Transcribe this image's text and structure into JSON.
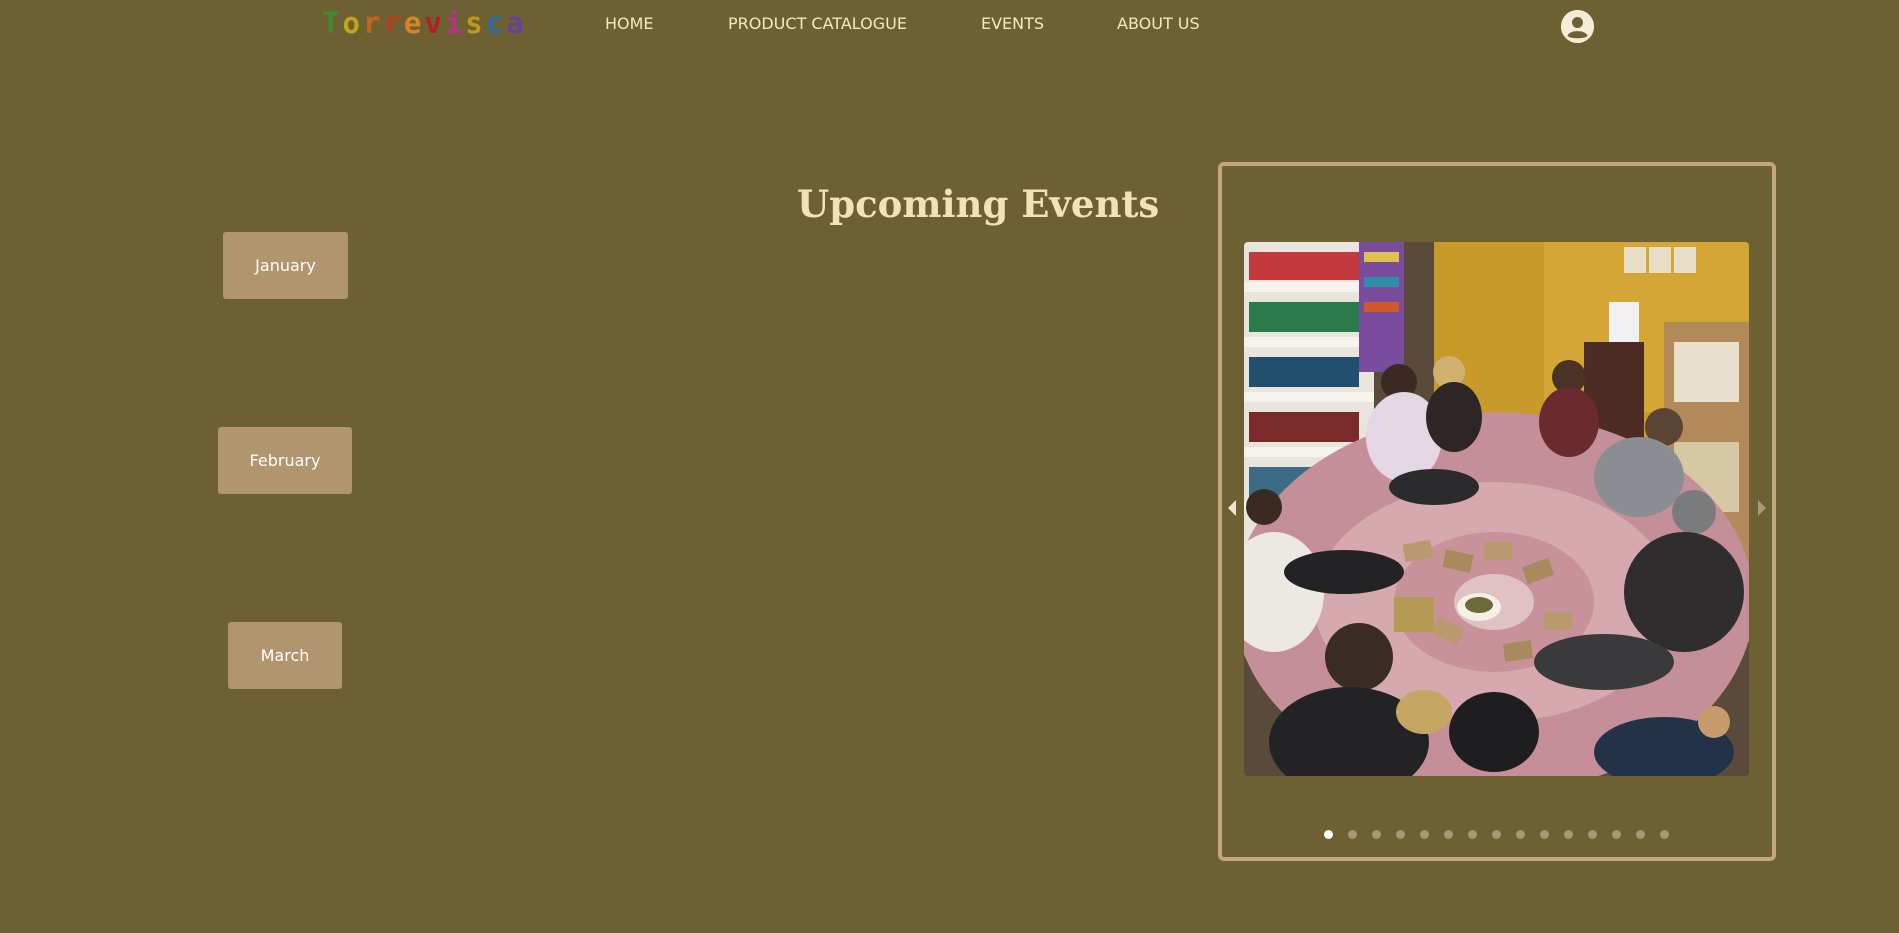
{
  "header": {
    "logo_letters": [
      {
        "ch": "T",
        "color": "#3e8c2f"
      },
      {
        "ch": "o",
        "color": "#c8a21c"
      },
      {
        "ch": "r",
        "color": "#c8651b"
      },
      {
        "ch": "r",
        "color": "#b93b1c"
      },
      {
        "ch": "e",
        "color": "#d88522"
      },
      {
        "ch": "v",
        "color": "#b61d24"
      },
      {
        "ch": "i",
        "color": "#b8328b"
      },
      {
        "ch": "s",
        "color": "#c0961e"
      },
      {
        "ch": "c",
        "color": "#2c6aa5"
      },
      {
        "ch": "a",
        "color": "#6a3f9a"
      }
    ],
    "nav": [
      {
        "label": "HOME"
      },
      {
        "label": "PRODUCT CATALOGUE"
      },
      {
        "label": "EVENTS"
      },
      {
        "label": "ABOUT US"
      }
    ],
    "account_icon": "user-account-icon"
  },
  "main": {
    "title": "Upcoming Events",
    "months": [
      {
        "label": "January"
      },
      {
        "label": "February"
      },
      {
        "label": "March"
      }
    ]
  },
  "slideshow": {
    "image_icon": "photo-of-people-sitting-on-rug-reading-cards",
    "prev_icon": "left-arrow-icon",
    "next_icon": "right-arrow-icon",
    "total_slides": 15,
    "active_slide": 1
  },
  "colors": {
    "background": "#6d6134",
    "button": "#b0956f",
    "frame": "#c3a67c",
    "title": "#f3e2b7",
    "nav_text": "#f3e7c4"
  }
}
